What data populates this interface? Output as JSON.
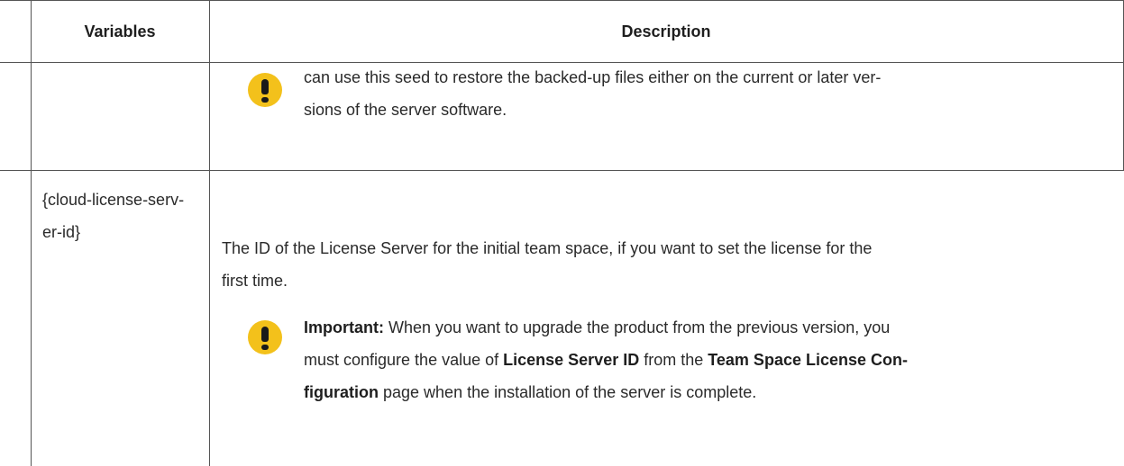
{
  "table": {
    "headers": {
      "variables": "Variables",
      "description": "Description"
    },
    "row1": {
      "variable": "",
      "note_line1": "can use this seed to restore the backed-up files either on the current or later ver-",
      "note_line2": "sions of the server software."
    },
    "row2": {
      "variable_line1": "{cloud-license-serv-",
      "variable_line2": "er-id}",
      "desc_line1": "The ID of the License Server for the initial team space, if you want to set the license for the",
      "desc_line2": "first time.",
      "important_label": "Important:",
      "important_text1": " When you want to upgrade the product from the previous version, you",
      "important_text2a": "must configure the value of ",
      "license_server_id": "License Server ID",
      "important_text2b": " from the ",
      "team_space_1": "Team Space License Con-",
      "team_space_2": "figuration",
      "important_text3": " page when the installation of the server is complete."
    }
  },
  "icons": {
    "warning": "warning-icon",
    "warning_color": "#f3c11b"
  }
}
